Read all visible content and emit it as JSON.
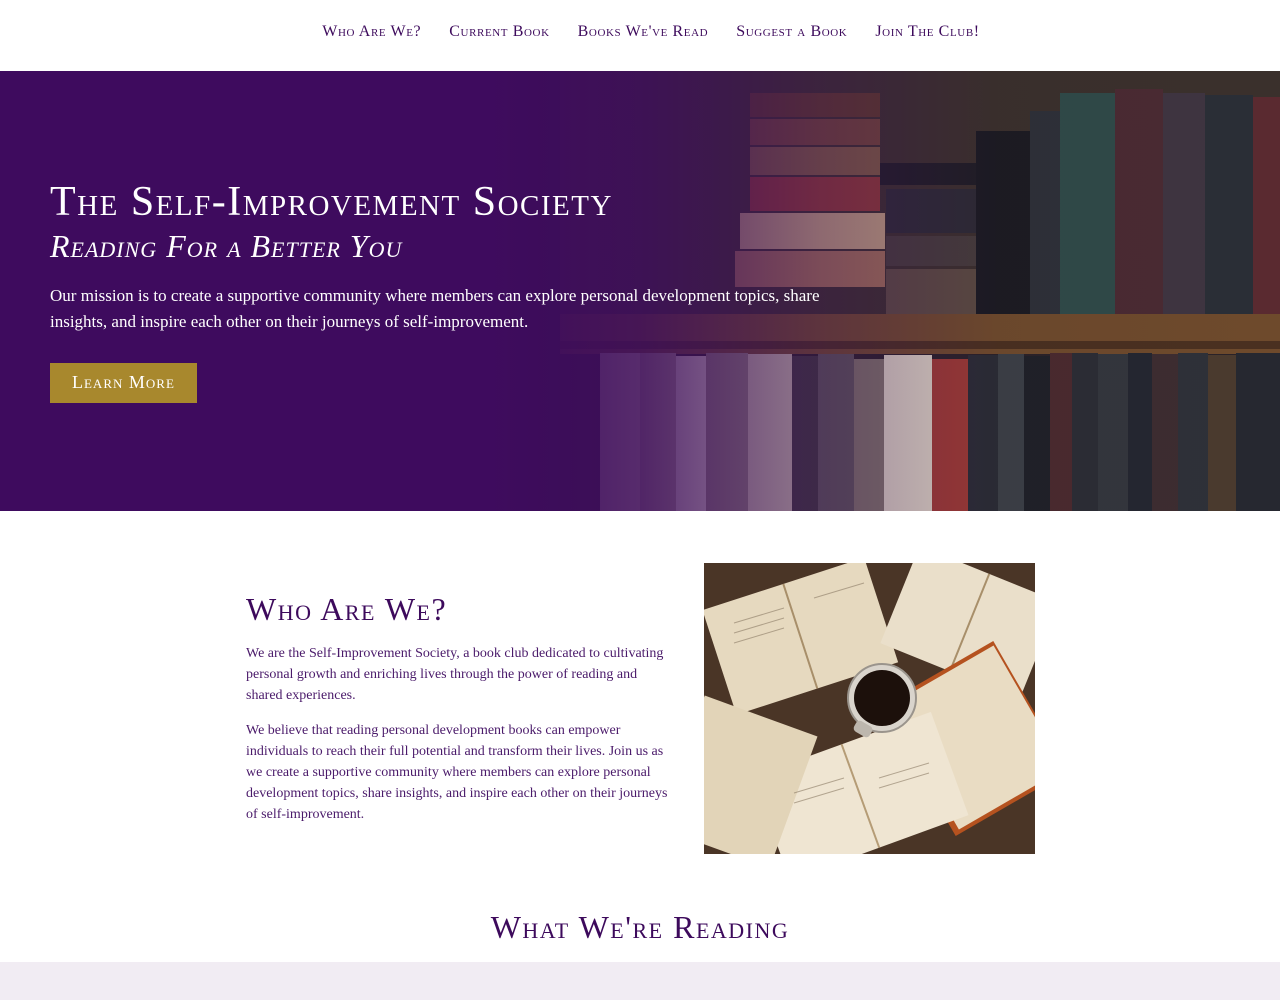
{
  "nav": {
    "items": [
      {
        "label": "Who Are We?"
      },
      {
        "label": "Current Book"
      },
      {
        "label": "Books We've Read"
      },
      {
        "label": "Suggest a Book"
      },
      {
        "label": "Join The Club!"
      }
    ]
  },
  "hero": {
    "title": "The Self-Improvement Society",
    "subtitle": "Reading For a Better You",
    "text": "Our mission is to create a supportive community where members can explore personal development topics, share insights, and inspire each other on their journeys of self-improvement.",
    "button_label": "Learn More"
  },
  "about": {
    "title": "Who Are We?",
    "paragraphs": [
      "We are the Self-Improvement Society, a book club dedicated to cultivating personal growth and enriching lives through the power of reading and shared experiences.",
      "We believe that reading personal development books can empower individuals to reach their full potential and transform their lives. Join us as we create a supportive community where members can explore personal development topics, share insights, and inspire each other on their journeys of self-improvement."
    ]
  },
  "reading": {
    "title": "What We're Reading"
  },
  "colors": {
    "brand_purple": "#3e0b5e",
    "accent_gold": "#a8882d",
    "band_lilac": "#f1ecf3"
  },
  "images": {
    "hero_background": "bookshelf-photo",
    "about_photo": "open-books-with-coffee-photo"
  }
}
